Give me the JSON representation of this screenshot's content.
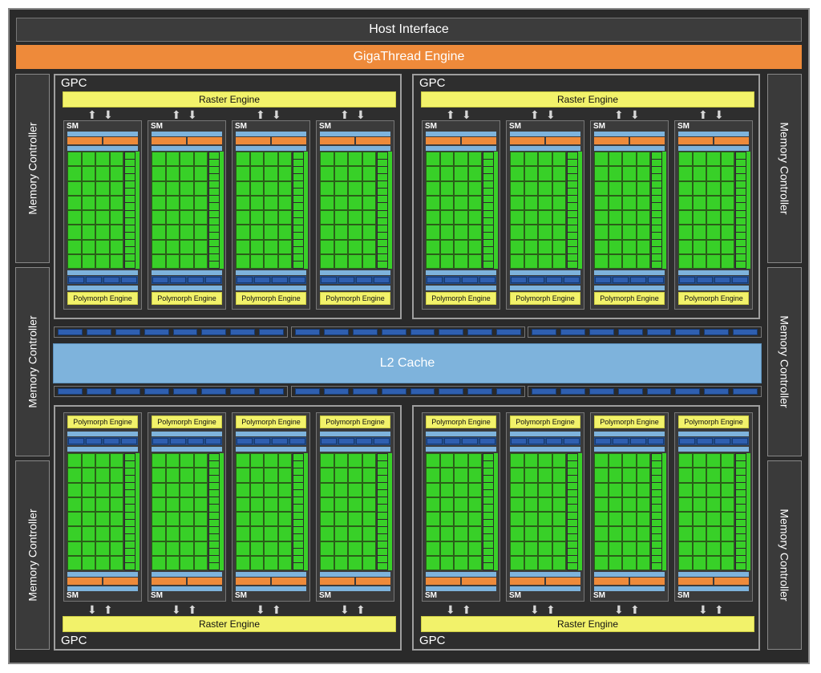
{
  "host_interface": "Host Interface",
  "gigathread_engine": "GigaThread Engine",
  "l2_cache": "L2 Cache",
  "memory_controller": "Memory Controller",
  "gpc_label": "GPC",
  "raster_engine": "Raster Engine",
  "sm_label": "SM",
  "polymorph_engine": "Polymorph Engine",
  "colors": {
    "core_green": "#38d028",
    "gigathread_orange": "#ee8a3a",
    "raster_yellow": "#f2f26a",
    "l2_blue": "#7eb3dc",
    "texture_blue": "#2f5fb0",
    "background": "#2a2a2a"
  }
}
